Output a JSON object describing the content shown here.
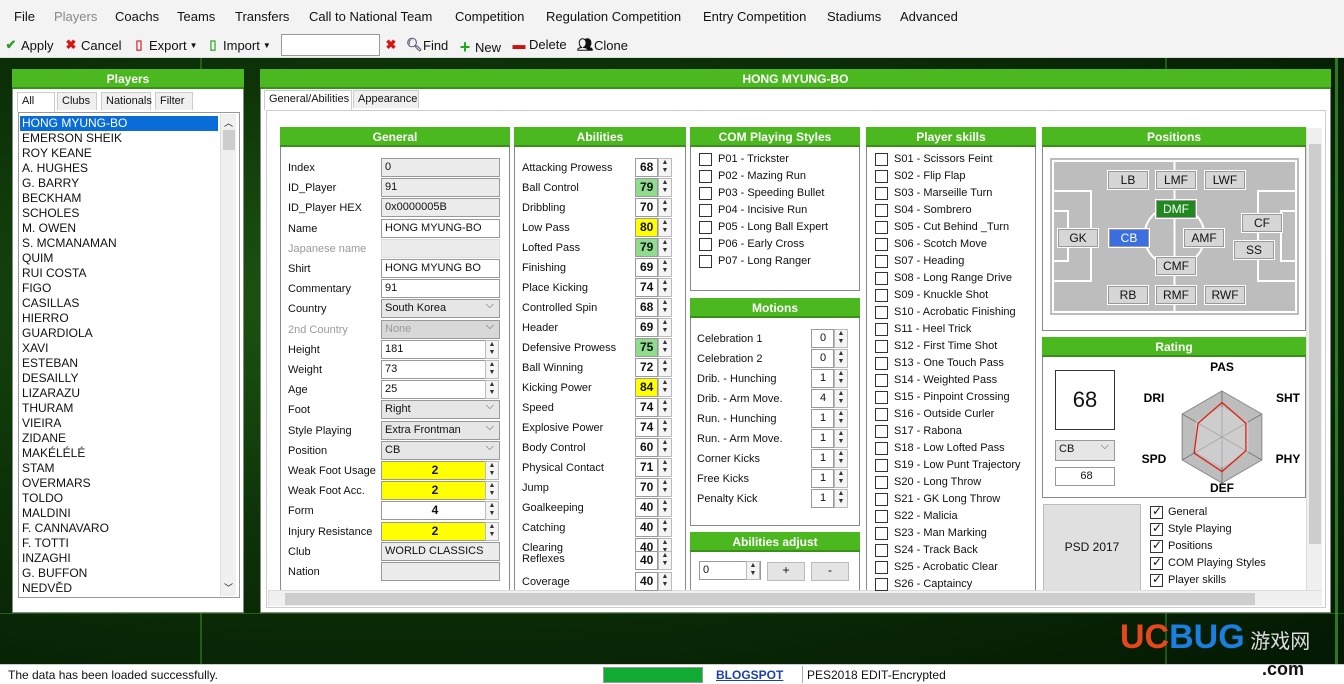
{
  "menu": [
    "File",
    "Players",
    "Coachs",
    "Teams",
    "Transfers",
    "Call to National Team",
    "Competition",
    "Regulation Competition",
    "Entry Competition",
    "Stadiums",
    "Advanced"
  ],
  "toolbar": {
    "apply": "Apply",
    "cancel": "Cancel",
    "export": "Export",
    "import": "Import",
    "search_value": "",
    "find": "Find",
    "new": "New",
    "delete": "Delete",
    "clone": "Clone"
  },
  "players_panel": {
    "title": "Players",
    "tabs": [
      "All",
      "Clubs",
      "Nationals",
      "Filter"
    ],
    "selected": "HONG MYUNG-BO",
    "list": [
      "HONG MYUNG-BO",
      "EMERSON SHEIK",
      "ROY KEANE",
      "A. HUGHES",
      "G. BARRY",
      "BECKHAM",
      "SCHOLES",
      "M. OWEN",
      "S. MCMANAMAN",
      "QUIM",
      "RUI COSTA",
      "FIGO",
      "CASILLAS",
      "HIERRO",
      "GUARDIOLA",
      "XAVI",
      "ESTEBAN",
      "DESAILLY",
      "LIZARAZU",
      "THURAM",
      "VIEIRA",
      "ZIDANE",
      "MAKÉLÉLÉ",
      "STAM",
      "OVERMARS",
      "TOLDO",
      "MALDINI",
      "F. CANNAVARO",
      "F. TOTTI",
      "INZAGHI",
      "G. BUFFON",
      "NEDVĚD"
    ]
  },
  "main": {
    "title": "HONG MYUNG-BO",
    "tabs": [
      "General/Abilities",
      "Appearance"
    ]
  },
  "general": {
    "title": "General",
    "fields": [
      {
        "label": "Index",
        "value": "0",
        "type": "ro"
      },
      {
        "label": "ID_Player",
        "value": "91",
        "type": "ro"
      },
      {
        "label": "ID_Player HEX",
        "value": "0x0000005B",
        "type": "ro"
      },
      {
        "label": "Name",
        "value": "HONG MYUNG-BO",
        "type": "text"
      },
      {
        "label": "Japanese name",
        "value": "",
        "type": "disabled"
      },
      {
        "label": "Shirt",
        "value": "HONG MYUNG BO",
        "type": "text"
      },
      {
        "label": "Commentary",
        "value": "91",
        "type": "text"
      },
      {
        "label": "Country",
        "value": "South Korea",
        "type": "select"
      },
      {
        "label": "2nd Country",
        "value": "None",
        "type": "select-disabled"
      },
      {
        "label": "Height",
        "value": "181",
        "type": "spin"
      },
      {
        "label": "Weight",
        "value": "73",
        "type": "spin"
      },
      {
        "label": "Age",
        "value": "25",
        "type": "spin"
      },
      {
        "label": "Foot",
        "value": "Right",
        "type": "select"
      },
      {
        "label": "Style Playing",
        "value": "Extra Frontman",
        "type": "select"
      },
      {
        "label": "Position",
        "value": "CB",
        "type": "select"
      },
      {
        "label": "Weak Foot Usage",
        "value": "2",
        "type": "spin-yellow"
      },
      {
        "label": "Weak Foot Acc.",
        "value": "2",
        "type": "spin-yellow"
      },
      {
        "label": "Form",
        "value": "4",
        "type": "spin-center"
      },
      {
        "label": "Injury Resistance",
        "value": "2",
        "type": "spin-yellow"
      },
      {
        "label": "Club",
        "value": "WORLD CLASSICS",
        "type": "ro"
      },
      {
        "label": "Nation",
        "value": "",
        "type": "ro"
      }
    ]
  },
  "abilities": {
    "title": "Abilities",
    "items": [
      {
        "label": "Attacking Prowess",
        "value": "68",
        "hl": ""
      },
      {
        "label": "Ball Control",
        "value": "79",
        "hl": "green"
      },
      {
        "label": "Dribbling",
        "value": "70",
        "hl": ""
      },
      {
        "label": "Low Pass",
        "value": "80",
        "hl": "yellow"
      },
      {
        "label": "Lofted Pass",
        "value": "79",
        "hl": "green"
      },
      {
        "label": "Finishing",
        "value": "69",
        "hl": ""
      },
      {
        "label": "Place Kicking",
        "value": "74",
        "hl": ""
      },
      {
        "label": "Controlled Spin",
        "value": "68",
        "hl": ""
      },
      {
        "label": "Header",
        "value": "69",
        "hl": ""
      },
      {
        "label": "Defensive Prowess",
        "value": "75",
        "hl": "green"
      },
      {
        "label": "Ball Winning",
        "value": "72",
        "hl": ""
      },
      {
        "label": "Kicking Power",
        "value": "84",
        "hl": "yellow"
      },
      {
        "label": "Speed",
        "value": "74",
        "hl": ""
      },
      {
        "label": "Explosive Power",
        "value": "74",
        "hl": ""
      },
      {
        "label": "Body Control",
        "value": "60",
        "hl": ""
      },
      {
        "label": "Physical Contact",
        "value": "71",
        "hl": ""
      },
      {
        "label": "Jump",
        "value": "70",
        "hl": ""
      },
      {
        "label": "Goalkeeping",
        "value": "40",
        "hl": ""
      },
      {
        "label": "Catching",
        "value": "40",
        "hl": ""
      },
      {
        "label": "Clearing",
        "value": "40",
        "hl": ""
      },
      {
        "label": "Reflexes",
        "value": "40",
        "hl": ""
      },
      {
        "label": "Coverage",
        "value": "40",
        "hl": ""
      }
    ]
  },
  "com_styles": {
    "title": "COM Playing Styles",
    "items": [
      "P01 - Trickster",
      "P02 - Mazing Run",
      "P03 - Speeding Bullet",
      "P04 - Incisive Run",
      "P05 - Long Ball Expert",
      "P06 - Early Cross",
      "P07 - Long Ranger"
    ]
  },
  "motions": {
    "title": "Motions",
    "items": [
      {
        "label": "Celebration 1",
        "value": "0"
      },
      {
        "label": "Celebration 2",
        "value": "0"
      },
      {
        "label": "Drib. - Hunching",
        "value": "1"
      },
      {
        "label": "Drib. - Arm Move.",
        "value": "4"
      },
      {
        "label": "Run. - Hunching",
        "value": "1"
      },
      {
        "label": "Run. - Arm Move.",
        "value": "1"
      },
      {
        "label": "Corner Kicks",
        "value": "1"
      },
      {
        "label": "Free Kicks",
        "value": "1"
      },
      {
        "label": "Penalty Kick",
        "value": "1"
      }
    ]
  },
  "abilities_adjust": {
    "title": "Abilities adjust",
    "value": "0",
    "plus": "+",
    "minus": "-"
  },
  "skills": {
    "title": "Player skills",
    "items": [
      "S01 - Scissors Feint",
      "S02 - Flip Flap",
      "S03 - Marseille Turn",
      "S04 - Sombrero",
      "S05 - Cut Behind _Turn",
      "S06 - Scotch Move",
      "S07 - Heading",
      "S08 - Long Range Drive",
      "S09 - Knuckle Shot",
      "S10 - Acrobatic Finishing",
      "S11 - Heel Trick",
      "S12 - First Time Shot",
      "S13 - One Touch Pass",
      "S14 - Weighted Pass",
      "S15 - Pinpoint Crossing",
      "S16 - Outside Curler",
      "S17 - Rabona",
      "S18 - Low Lofted Pass",
      "S19 - Low Punt Trajectory",
      "S20 - Long Throw",
      "S21 - GK Long Throw",
      "S22 - Malicia",
      "S23 - Man Marking",
      "S24 - Track Back",
      "S25 - Acrobatic Clear",
      "S26 - Captaincy"
    ]
  },
  "positions": {
    "title": "Positions",
    "main": "CB",
    "secondary": "DMF",
    "list": [
      "LB",
      "LMF",
      "LWF",
      "DMF",
      "CF",
      "GK",
      "CB",
      "AMF",
      "SS",
      "CMF",
      "RB",
      "RMF",
      "RWF"
    ]
  },
  "rating": {
    "title": "Rating",
    "overall": "68",
    "position": "CB",
    "position_rating": "68",
    "axes": [
      "PAS",
      "SHT",
      "PHY",
      "DEF",
      "SPD",
      "DRI"
    ],
    "radar_levels": [
      0.75,
      0.6,
      0.6,
      0.75,
      0.7,
      0.6
    ]
  },
  "psd": {
    "label": "PSD 2017"
  },
  "copy_options": [
    {
      "label": "General",
      "checked": true
    },
    {
      "label": "Style Playing",
      "checked": true
    },
    {
      "label": "Positions",
      "checked": true
    },
    {
      "label": "COM Playing Styles",
      "checked": true
    },
    {
      "label": "Player skills",
      "checked": true
    }
  ],
  "status": {
    "message": "The data has been loaded successfully.",
    "link": "BLOGSPOT",
    "edition": "PES2018 EDIT-Encrypted",
    "progress": 1.0
  },
  "watermark": "UCBUG 游戏网 .com",
  "colors": {
    "header_green": "#4bb81f",
    "selected_blue": "#0a6cd6",
    "pos_main": "#3b6fe0",
    "pos_secondary": "#1e8a1e",
    "highlight_yellow": "#ffff00",
    "highlight_green": "#8fdc8f"
  }
}
